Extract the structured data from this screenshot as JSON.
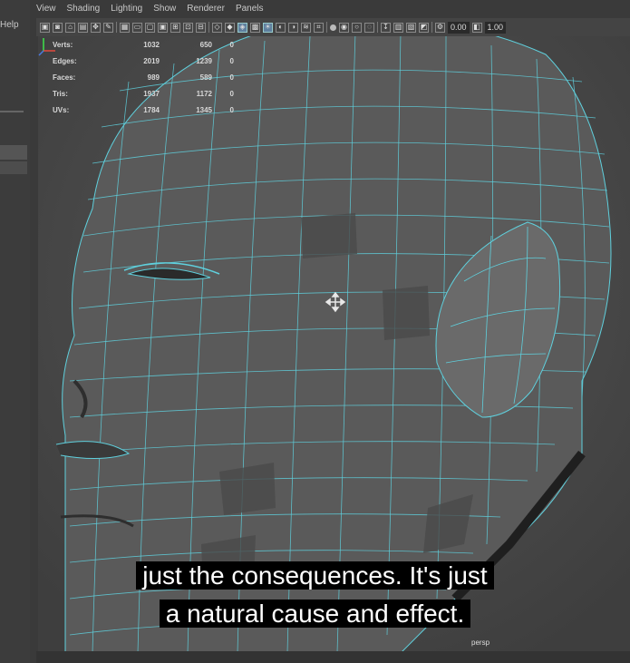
{
  "left_panel": {
    "help_label": "Help"
  },
  "menu": {
    "items": [
      "View",
      "Shading",
      "Lighting",
      "Show",
      "Renderer",
      "Panels"
    ]
  },
  "toolbar": {
    "field1": "0.00",
    "field2": "1.00"
  },
  "hud": {
    "rows": [
      {
        "label": "Verts:",
        "v1": "1032",
        "v2": "650",
        "v3": "0"
      },
      {
        "label": "Edges:",
        "v1": "2019",
        "v2": "1239",
        "v3": "0"
      },
      {
        "label": "Faces:",
        "v1": "989",
        "v2": "589",
        "v3": "0"
      },
      {
        "label": "Tris:",
        "v1": "1937",
        "v2": "1172",
        "v3": "0"
      },
      {
        "label": "UVs:",
        "v1": "1784",
        "v2": "1345",
        "v3": "0"
      }
    ]
  },
  "viewport": {
    "camera": "persp"
  },
  "subtitle": {
    "line1": "just the consequences. It's just",
    "line2": "a natural cause and effect."
  },
  "colors": {
    "wire": "#5fd0dd",
    "mesh": "#585858",
    "background": "#4a4a4a"
  }
}
